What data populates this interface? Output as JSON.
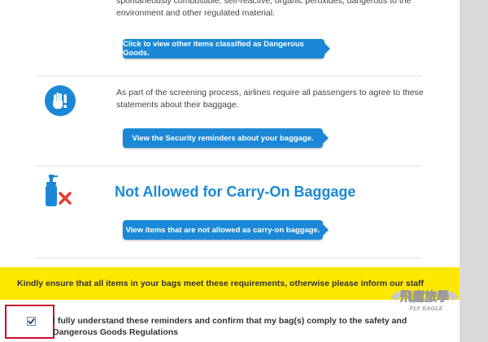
{
  "top_section": {
    "text": "spontaneously combustible, self-reactive, organic peroxides, dangerous to the environment and other regulated material.",
    "button_label": "Click to view other items classified as Dangerous Goods."
  },
  "security_section": {
    "text": "As part of the screening process, airlines require all passengers to agree to these statements about their baggage.",
    "button_label": "View the Security reminders about your baggage."
  },
  "not_allowed_section": {
    "heading": "Not Allowed for Carry-On Baggage",
    "button_label": "View items that are not allowed as carry-on baggage."
  },
  "notice": {
    "text": "Kindly ensure that all items in your bags meet these requirements, otherwise please inform our staff"
  },
  "confirmation": {
    "checked": true,
    "text": "I fully understand these reminders and confirm that my bag(s) comply to the safety and Dangerous Goods Regulations"
  },
  "watermark": {
    "text_cn": "飛鷹旅學",
    "text_en": "FLY EAGLE"
  },
  "colors": {
    "accent_blue": "#1a88d6",
    "notice_yellow": "#ffe800",
    "highlight_red": "#c8102e",
    "cross_red": "#e23b2e"
  }
}
